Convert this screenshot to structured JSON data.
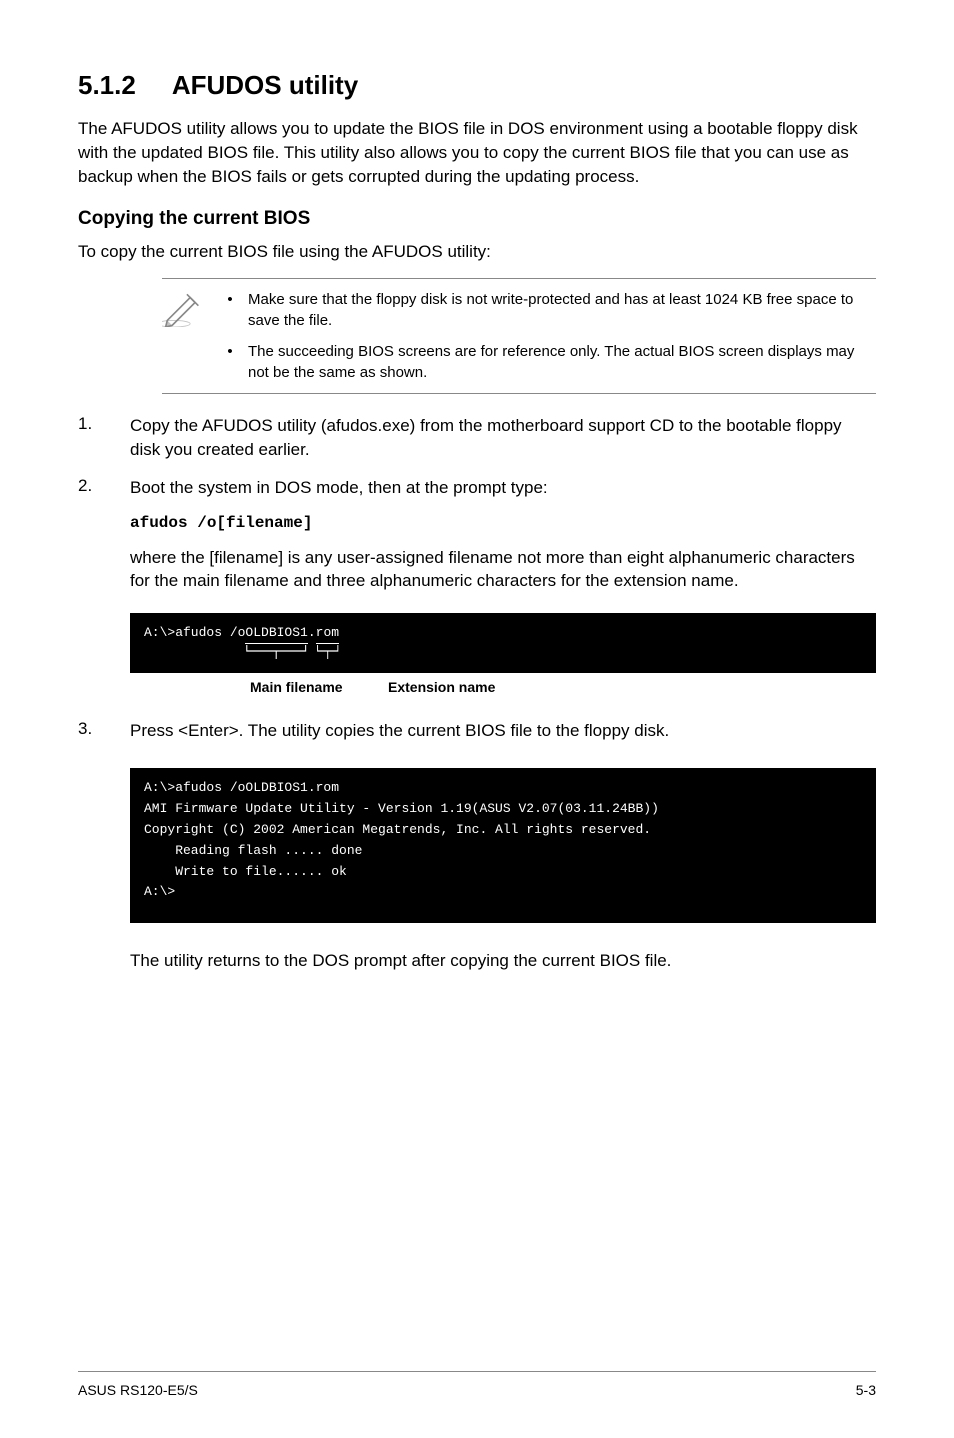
{
  "section": {
    "number": "5.1.2",
    "title": "AFUDOS utility"
  },
  "intro": "The AFUDOS utility allows you to update the BIOS file in DOS environment using a bootable floppy disk with the updated BIOS file. This utility also allows you to copy the current BIOS file that you can use as backup when the BIOS fails or gets corrupted during the updating process.",
  "subsection": {
    "title": "Copying the current BIOS",
    "lead": "To copy the current BIOS file using the AFUDOS utility:"
  },
  "notes": [
    "Make sure that the floppy disk is not write-protected and has at least 1024 KB free space to save the file.",
    "The succeeding BIOS screens are for reference only. The actual BIOS screen displays may not be the same as shown."
  ],
  "steps": {
    "s1": {
      "num": "1.",
      "text": "Copy the AFUDOS utility (afudos.exe) from the motherboard support CD to the bootable floppy disk you created earlier."
    },
    "s2": {
      "num": "2.",
      "text": "Boot the system in DOS mode, then at the prompt type:",
      "cmd": "afudos /o[filename]",
      "after": "where the [filename] is any user-assigned filename not more than eight alphanumeric characters  for the main filename and three alphanumeric characters for the extension name."
    },
    "s3": {
      "num": "3.",
      "text": "Press <Enter>. The utility copies the current BIOS file to the floppy disk."
    }
  },
  "console1": {
    "prefix": "A:\\>afudos /o",
    "main": "OLDBIOS1",
    "dot": ".",
    "ext": "rom"
  },
  "labels": {
    "main": "Main filename",
    "ext": "Extension name"
  },
  "console2": "A:\\>afudos /oOLDBIOS1.rom\nAMI Firmware Update Utility - Version 1.19(ASUS V2.07(03.11.24BB))\nCopyright (C) 2002 American Megatrends, Inc. All rights reserved.\n    Reading flash ..... done\n    Write to file...... ok\nA:\\>",
  "closing": "The utility returns to the DOS prompt after copying the current BIOS file.",
  "footer": {
    "left": "ASUS RS120-E5/S",
    "right": "5-3"
  }
}
